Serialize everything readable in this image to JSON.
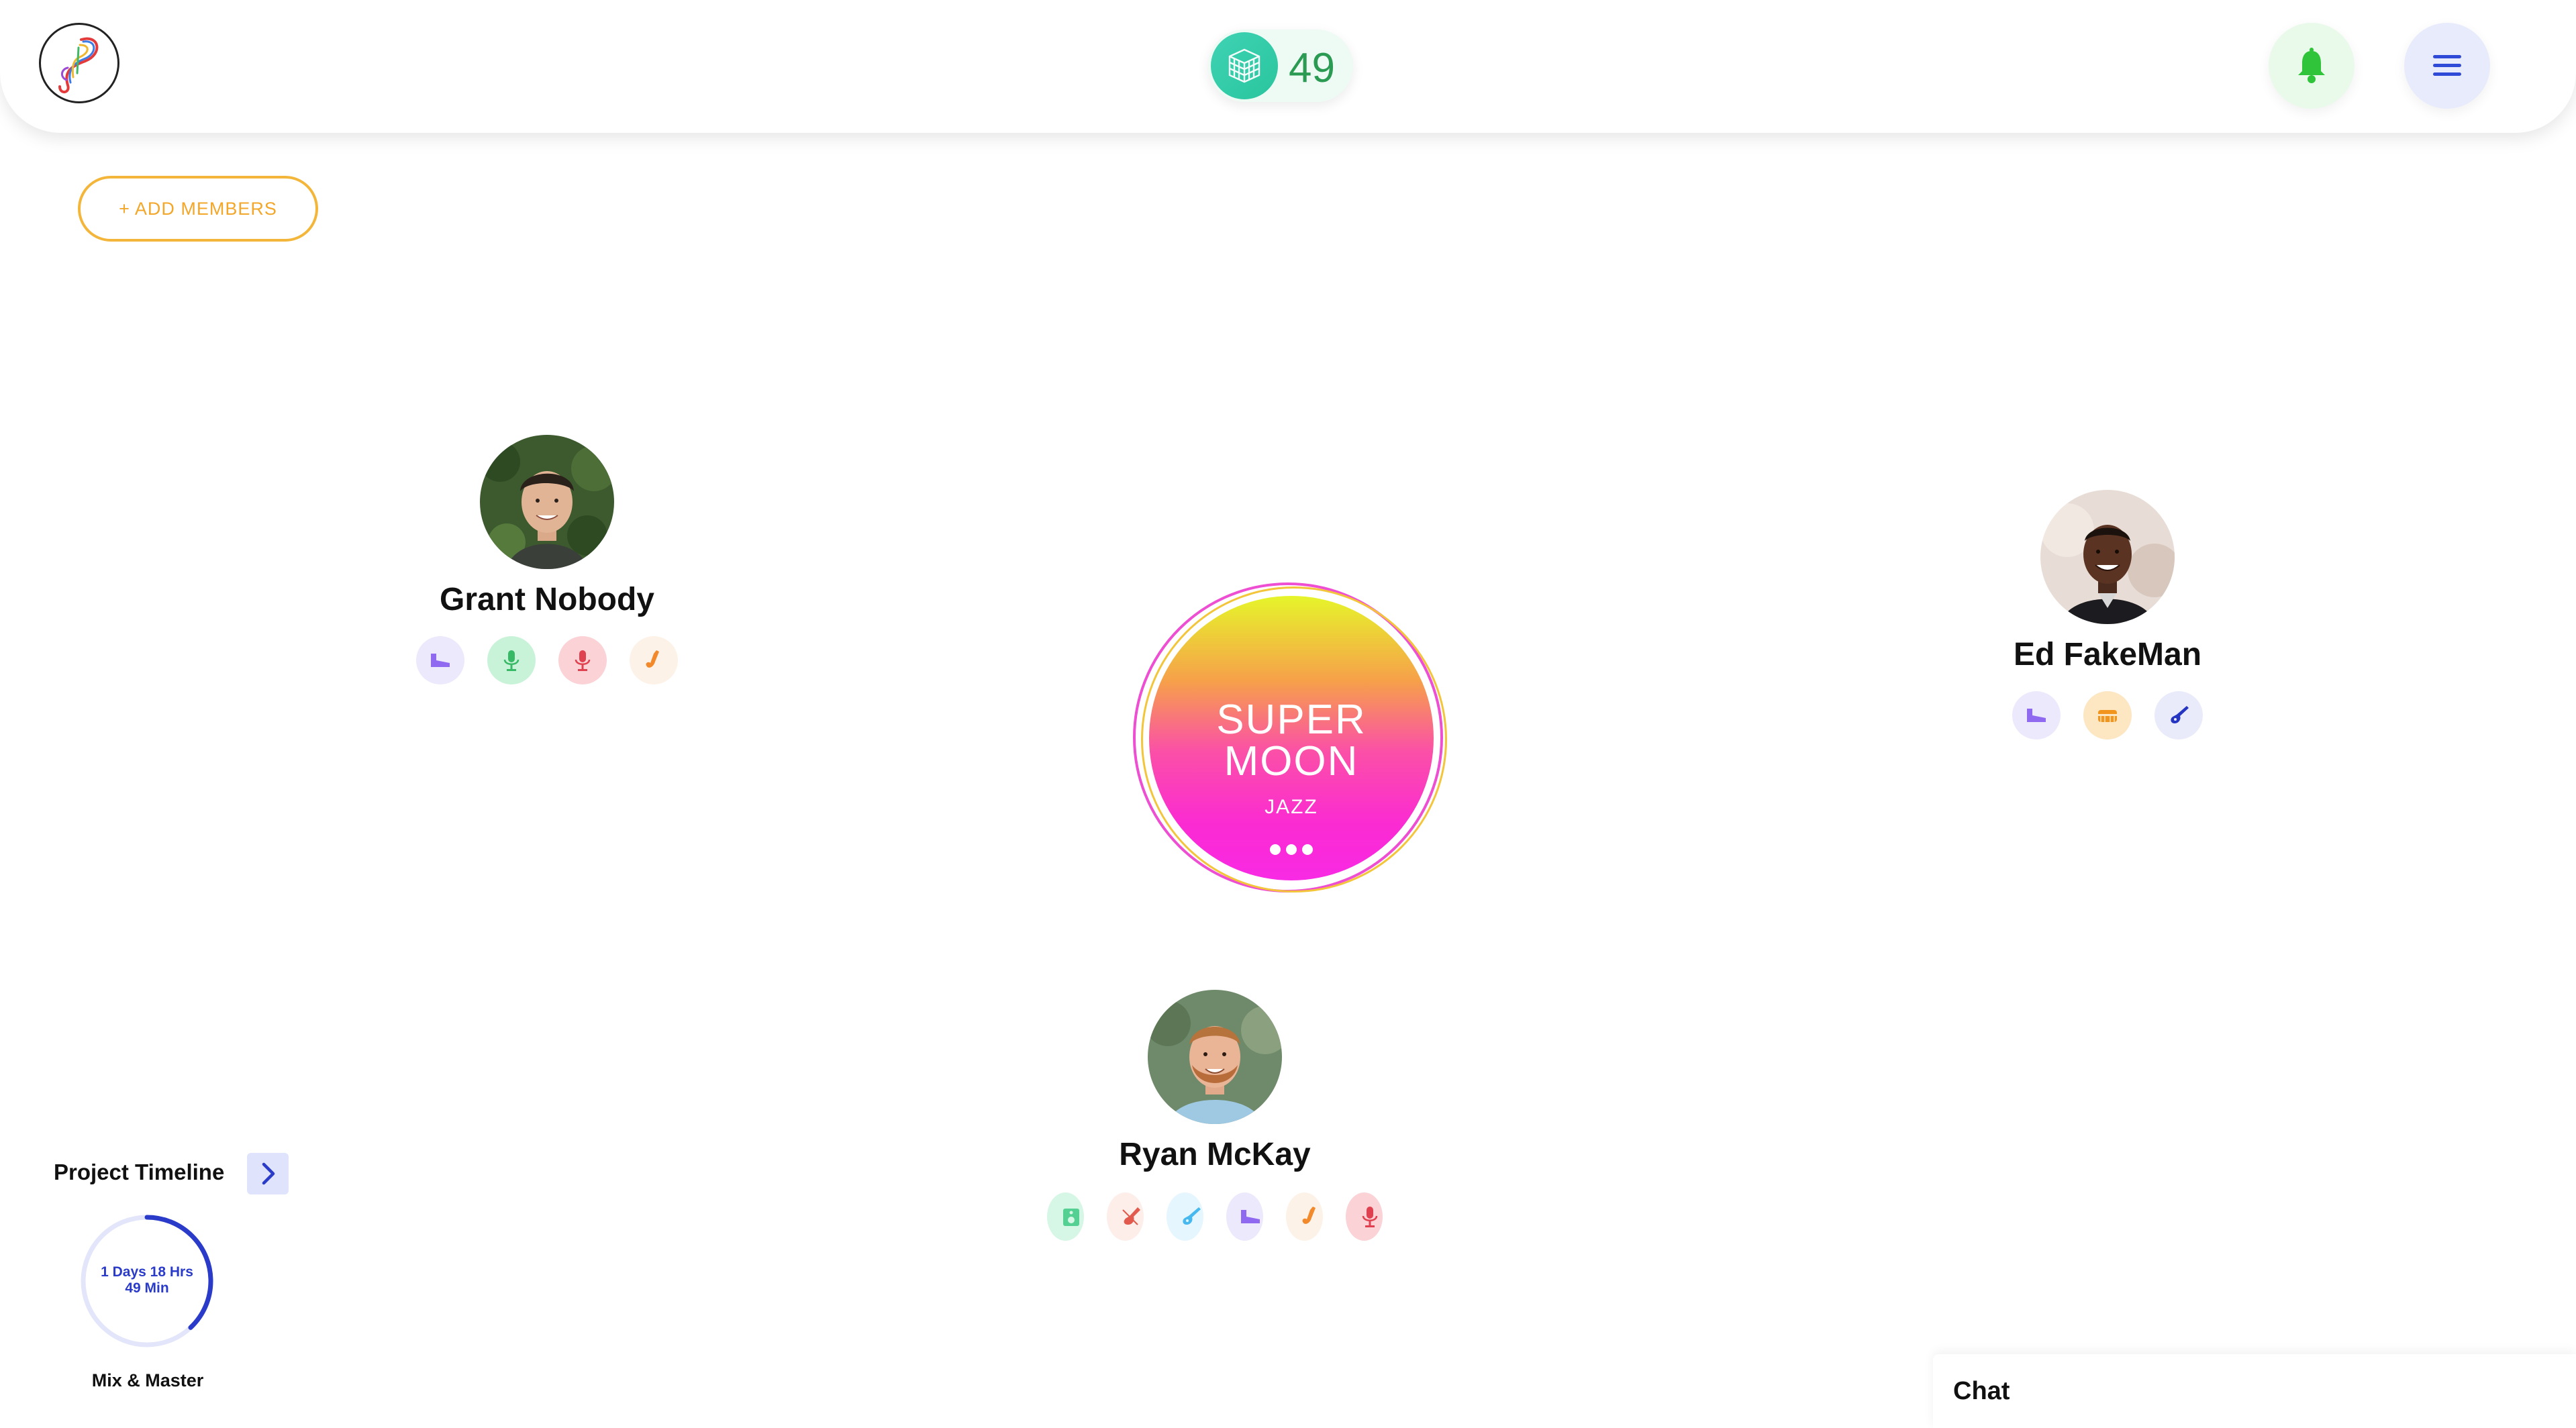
{
  "header": {
    "logo_icon": "brand-logo-icon",
    "credits_icon": "cube-grid-icon",
    "credits_count": "49",
    "notifications_icon": "bell-icon",
    "menu_icon": "hamburger-menu-icon"
  },
  "actions": {
    "add_members_label": "+ ADD MEMBERS"
  },
  "members": [
    {
      "name": "Grant Nobody",
      "skills": [
        {
          "icon": "piano-icon",
          "bg": "#ece9fd",
          "color": "#8f6af0"
        },
        {
          "icon": "microphone-icon",
          "bg": "#c9f3d9",
          "color": "#37b966"
        },
        {
          "icon": "microphone-icon",
          "bg": "#fbd2d6",
          "color": "#e04150"
        },
        {
          "icon": "saxophone-icon",
          "bg": "#fdf2e7",
          "color": "#f28a2c"
        }
      ]
    },
    {
      "name": "Ed FakeMan",
      "skills": [
        {
          "icon": "piano-icon",
          "bg": "#ece9fd",
          "color": "#8f6af0"
        },
        {
          "icon": "drum-icon",
          "bg": "#fde6c2",
          "color": "#f2951d"
        },
        {
          "icon": "electric-guitar-icon",
          "bg": "#e9ebfa",
          "color": "#2535c2"
        }
      ]
    },
    {
      "name": "Ryan McKay",
      "skills": [
        {
          "icon": "speaker-icon",
          "bg": "#d6f6e6",
          "color": "#55d093"
        },
        {
          "icon": "violin-icon",
          "bg": "#fdeee9",
          "color": "#e25a4d"
        },
        {
          "icon": "electric-guitar-icon",
          "bg": "#e5f6fe",
          "color": "#48b9ef"
        },
        {
          "icon": "piano-icon",
          "bg": "#ece9fd",
          "color": "#8f6af0"
        },
        {
          "icon": "saxophone-icon",
          "bg": "#fdf2e7",
          "color": "#f28a2c"
        },
        {
          "icon": "microphone-icon",
          "bg": "#fbd2d6",
          "color": "#e04150"
        }
      ]
    }
  ],
  "project": {
    "title_line1": "SUPER",
    "title_line2": "MOON",
    "genre": "JAZZ",
    "more_icon": "more-dots-icon"
  },
  "timeline": {
    "label": "Project Timeline",
    "remaining_line1": "1 Days 18 Hrs",
    "remaining_line2": "49 Min",
    "stage": "Mix & Master",
    "progress": 0.38,
    "ring_color": "#2a3bc9",
    "track_color": "#e3e6fb"
  },
  "chat": {
    "title": "Chat"
  }
}
